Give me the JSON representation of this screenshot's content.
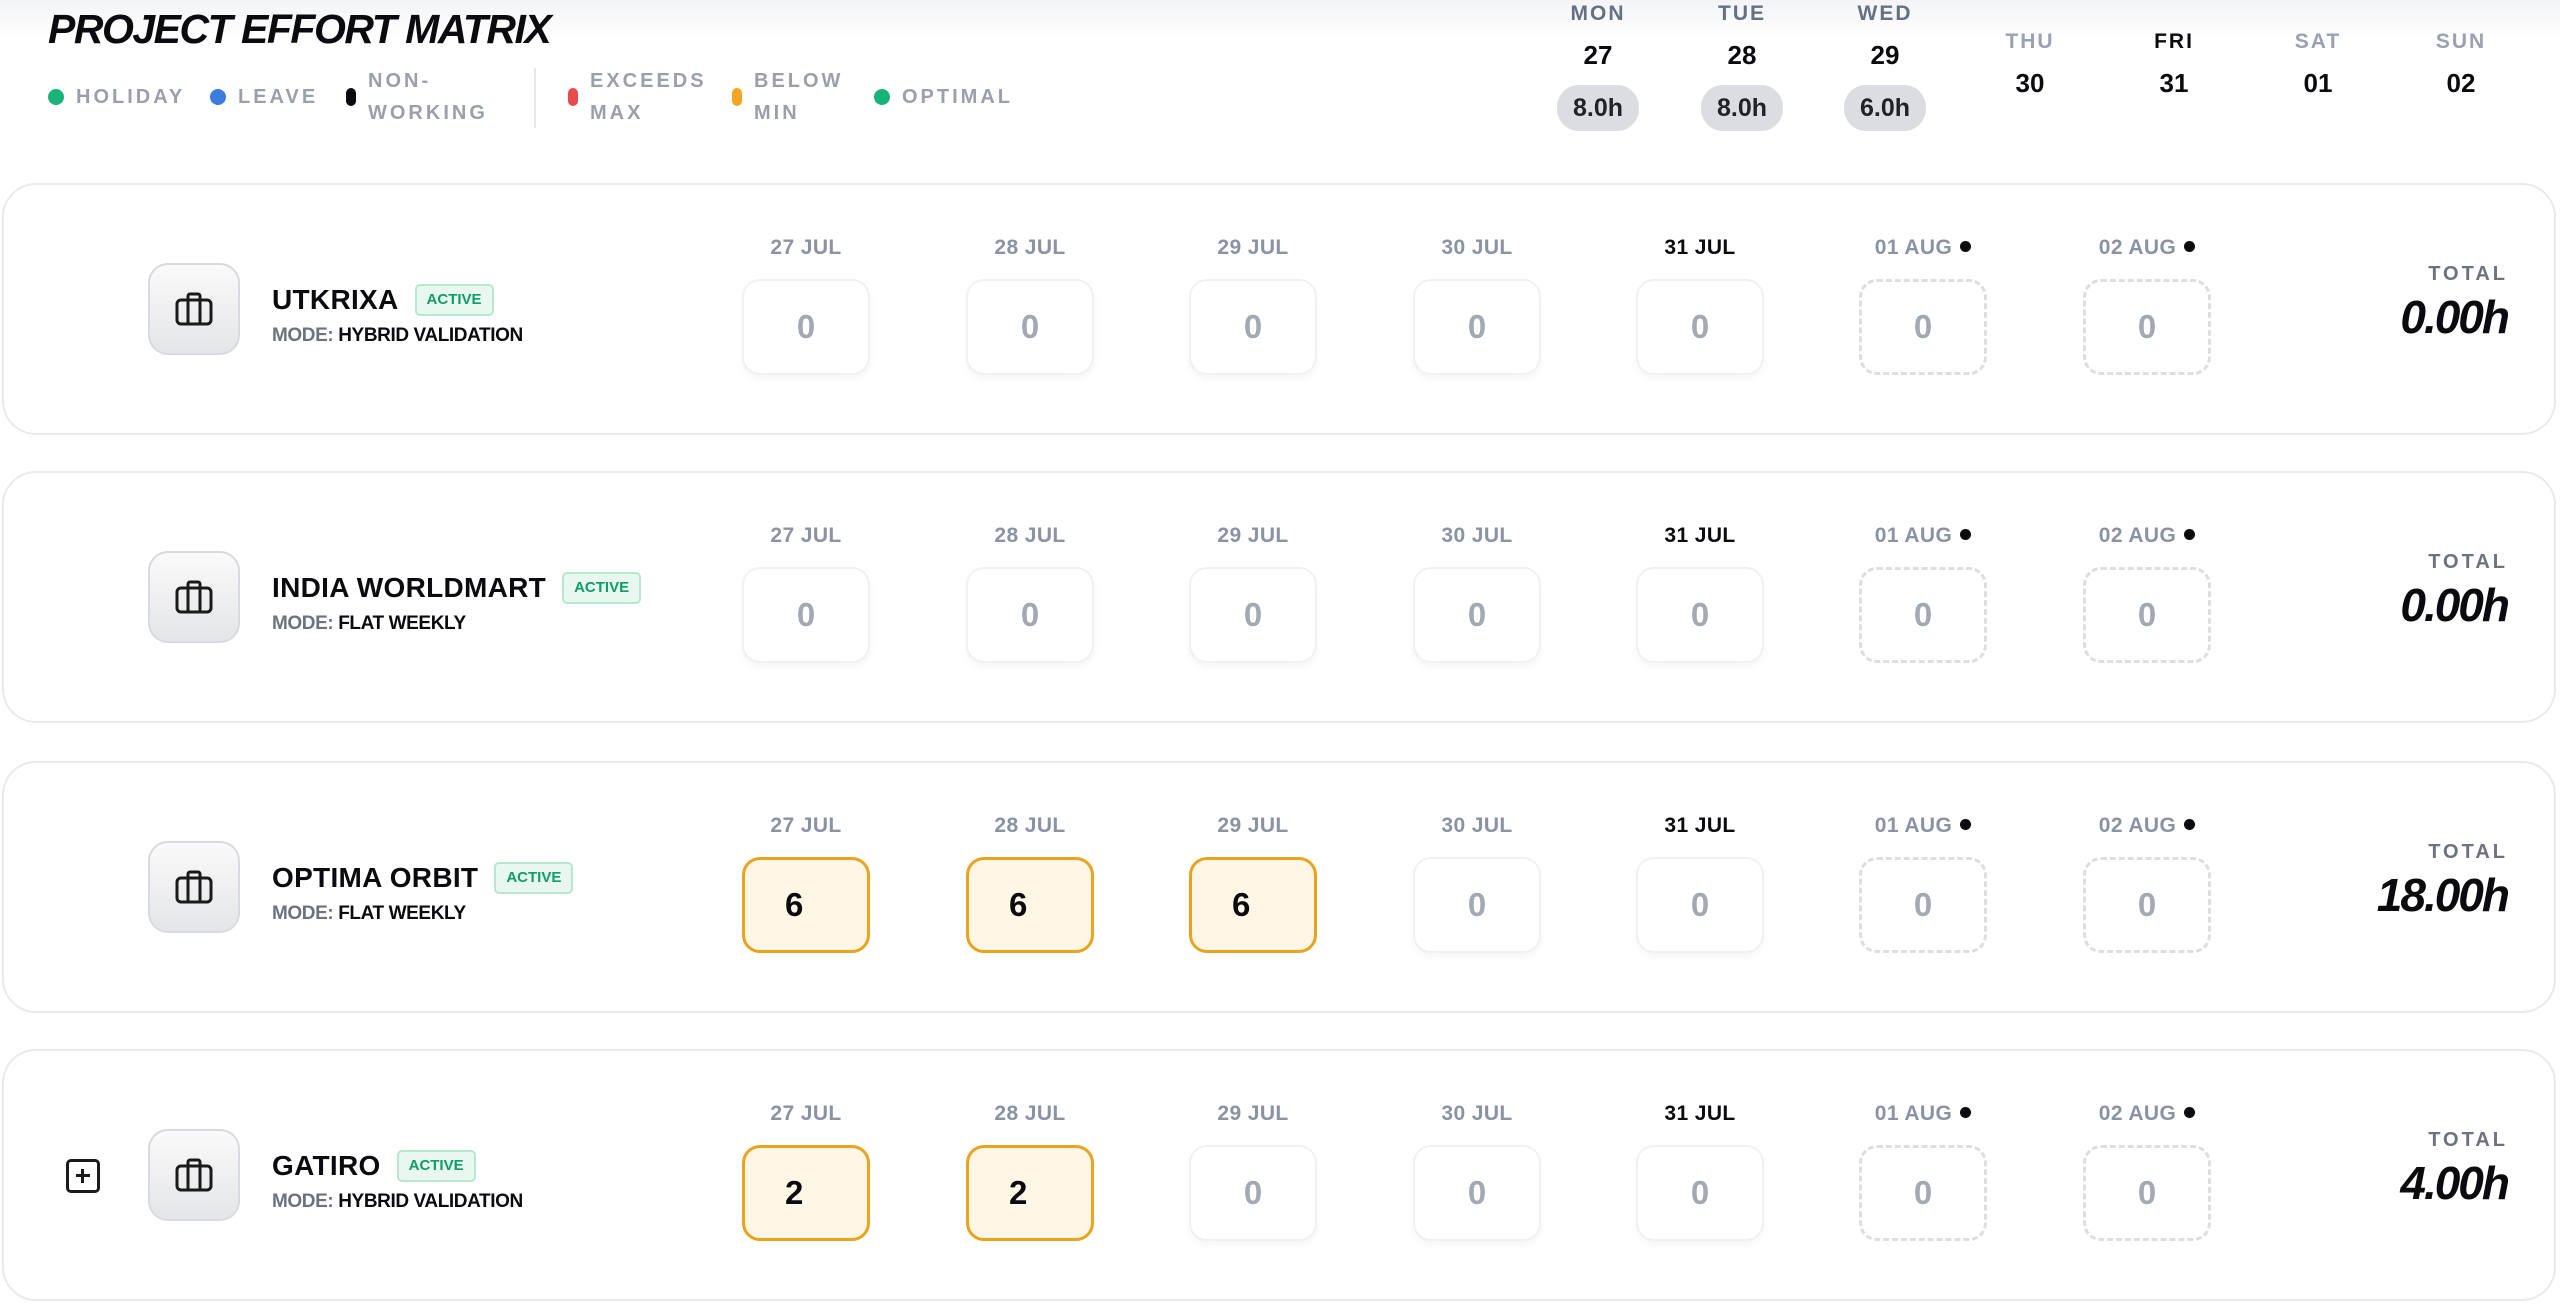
{
  "page": {
    "title": "PROJECT EFFORT MATRIX"
  },
  "legend": [
    {
      "label": "HOLIDAY",
      "color": "#19b37a"
    },
    {
      "label": "LEAVE",
      "color": "#3b7ddd"
    },
    {
      "label": "NON-WORKING",
      "color": "#0b0b0f"
    },
    {
      "label": "EXCEEDS MAX",
      "color": "#e94b4b"
    },
    {
      "label": "BELOW MIN",
      "color": "#f2a623"
    },
    {
      "label": "OPTIMAL",
      "color": "#19b37a"
    }
  ],
  "week": [
    {
      "dow": "MON",
      "date": "27",
      "hours": "8.0h"
    },
    {
      "dow": "TUE",
      "date": "28",
      "hours": "8.0h"
    },
    {
      "dow": "WED",
      "date": "29",
      "hours": "6.0h"
    },
    {
      "dow": "THU",
      "date": "30",
      "hours": ""
    },
    {
      "dow": "FRI",
      "date": "31",
      "hours": "",
      "today": true
    },
    {
      "dow": "SAT",
      "date": "01",
      "hours": ""
    },
    {
      "dow": "SUN",
      "date": "02",
      "hours": ""
    }
  ],
  "day_labels": [
    "27 JUL",
    "28 JUL",
    "29 JUL",
    "30 JUL",
    "31 JUL",
    "01 AUG",
    "02 AUG"
  ],
  "projects": [
    {
      "name": "UTKRIXA",
      "status": "ACTIVE",
      "mode_key": "MODE:",
      "mode_val": "HYBRID VALIDATION",
      "values": [
        "0",
        "0",
        "0",
        "0",
        "0",
        "0",
        "0"
      ],
      "total_label": "TOTAL",
      "total": "0.00h"
    },
    {
      "name": "INDIA WORLDMART",
      "status": "ACTIVE",
      "mode_key": "MODE:",
      "mode_val": "FLAT WEEKLY",
      "values": [
        "0",
        "0",
        "0",
        "0",
        "0",
        "0",
        "0"
      ],
      "total_label": "TOTAL",
      "total": "0.00h"
    },
    {
      "name": "OPTIMA ORBIT",
      "status": "ACTIVE",
      "mode_key": "MODE:",
      "mode_val": "FLAT WEEKLY",
      "values": [
        "6",
        "6",
        "6",
        "0",
        "0",
        "0",
        "0"
      ],
      "total_label": "TOTAL",
      "total": "18.00h"
    },
    {
      "name": "GATIRO",
      "status": "ACTIVE",
      "mode_key": "MODE:",
      "mode_val": "HYBRID VALIDATION",
      "values": [
        "2",
        "2",
        "0",
        "0",
        "0",
        "0",
        "0"
      ],
      "total_label": "TOTAL",
      "total": "4.00h"
    }
  ]
}
